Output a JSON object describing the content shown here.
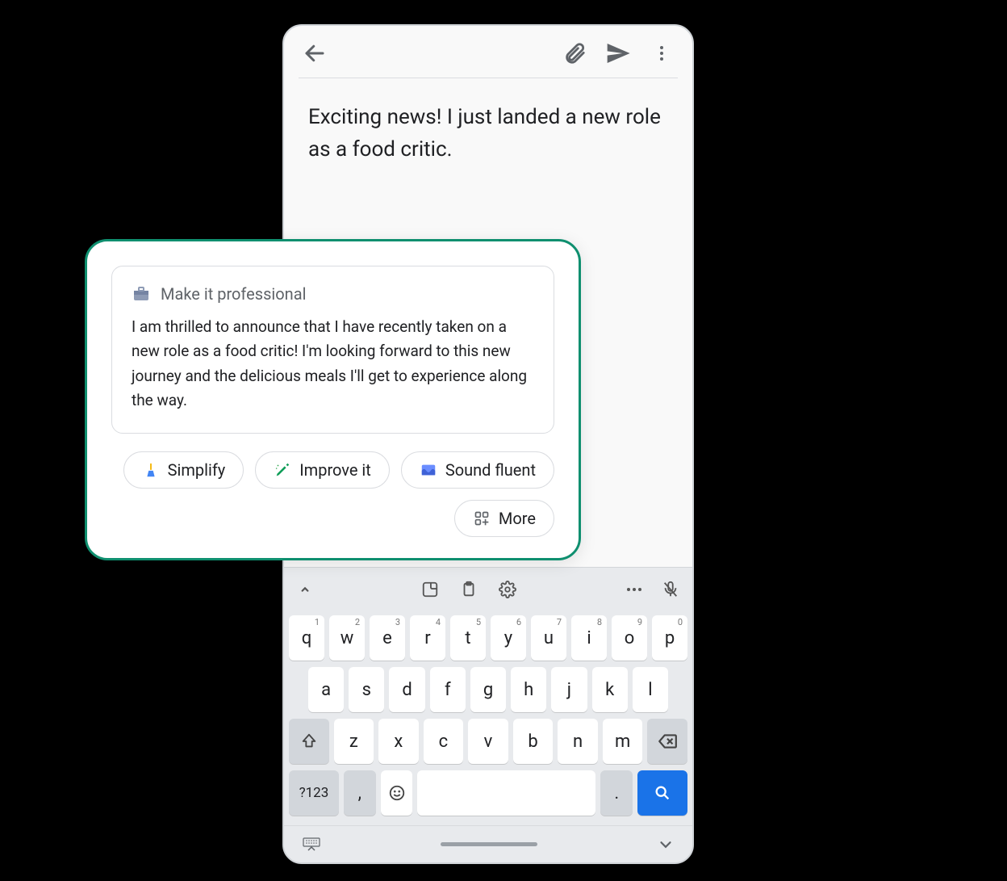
{
  "compose": {
    "body_text": "Exciting news! I just landed a new role as a food critic."
  },
  "suggestion": {
    "title": "Make it professional",
    "body": "I am thrilled to announce that I have recently taken on a new role as a food critic! I'm looking forward to this new journey and the delicious meals I'll get to experience along the way."
  },
  "chips": {
    "simplify": "Simplify",
    "improve": "Improve it",
    "fluent": "Sound fluent",
    "more": "More"
  },
  "keyboard": {
    "row1": [
      "q",
      "w",
      "e",
      "r",
      "t",
      "y",
      "u",
      "i",
      "o",
      "p"
    ],
    "row1_nums": [
      "1",
      "2",
      "3",
      "4",
      "5",
      "6",
      "7",
      "8",
      "9",
      "0"
    ],
    "row2": [
      "a",
      "s",
      "d",
      "f",
      "g",
      "h",
      "j",
      "k",
      "l"
    ],
    "row3": [
      "z",
      "x",
      "c",
      "v",
      "b",
      "n",
      "m"
    ],
    "symbols_key": "?123",
    "comma": ",",
    "period": "."
  }
}
